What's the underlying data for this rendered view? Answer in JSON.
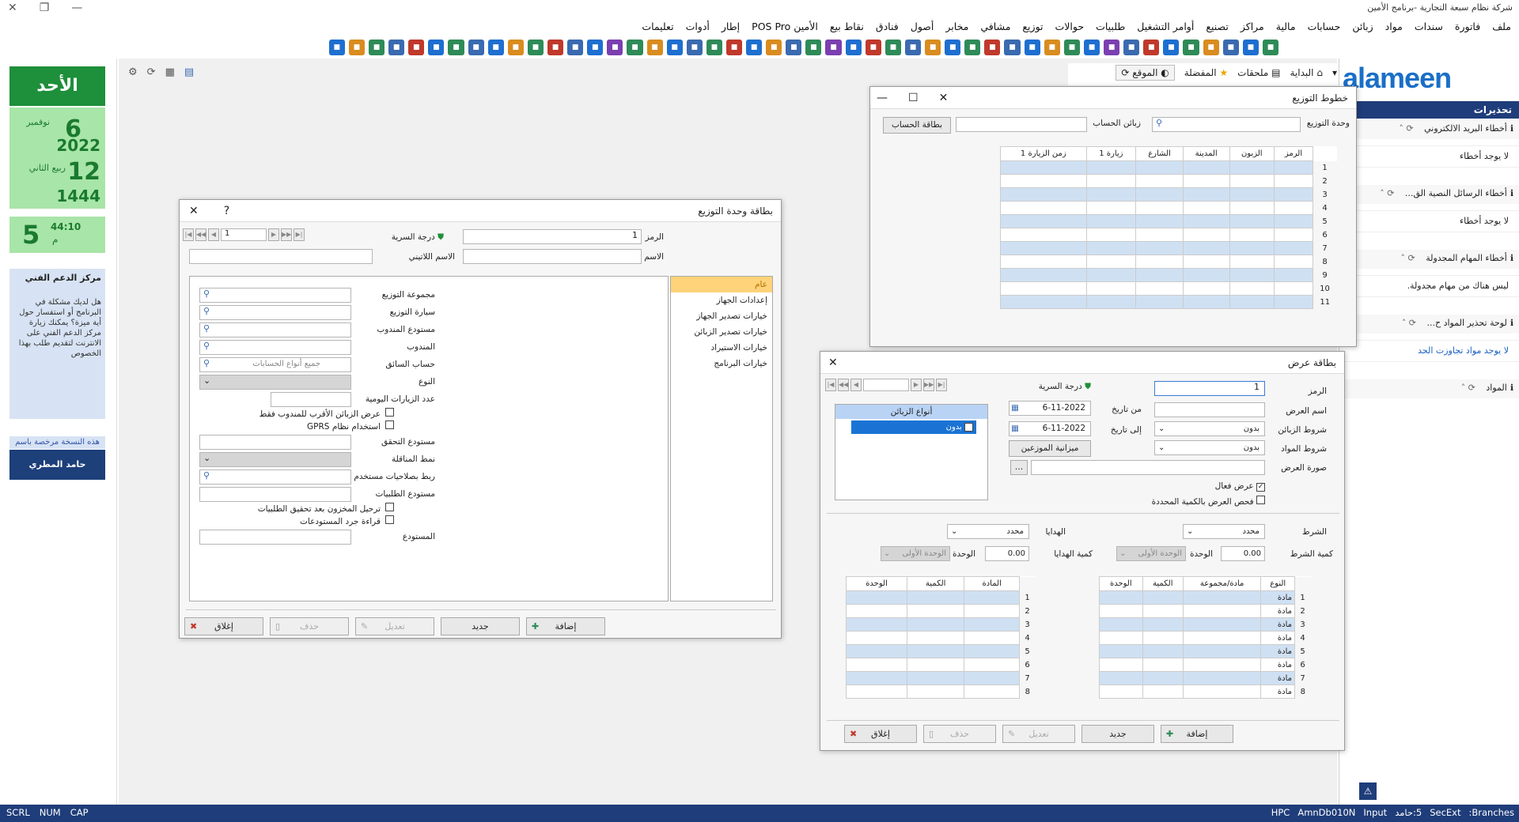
{
  "app_title": "شركة نظام سبعة التجارية -برنامج الأمين",
  "window_controls": {
    "close": "✕",
    "restore": "❐",
    "minimize": "—"
  },
  "menu": [
    "ملف",
    "فاتورة",
    "سندات",
    "مواد",
    "زبائن",
    "حسابات",
    "مالية",
    "مراكز",
    "تصنيع",
    "أوامر التشغيل",
    "طلبيات",
    "حوالات",
    "توزيع",
    "مشافي",
    "مخابر",
    "أصول",
    "فنادق",
    "نقاط بيع",
    "الأمين POS Pro",
    "إطار",
    "أدوات",
    "تعليمات"
  ],
  "tabs": {
    "home": "البداية",
    "notes": "ملحقات",
    "favorites": "المفضلة",
    "site": "الموقع"
  },
  "logo": "alameen",
  "left_panel": {
    "day": "الأحد",
    "greg_day": "6",
    "greg_month": "نوفمبر",
    "greg_year": "2022",
    "hijri_day": "12",
    "hijri_month": "ربيع الثاني",
    "hijri_year": "1444",
    "clock_min": "44:10",
    "clock_hour": "5",
    "clock_ampm": "م",
    "support_title": "مركز الدعم الفني",
    "support_text": "هل لديك مشكلة في البرنامج أو استفسار حول أية ميزة؟ يمكنك زيارة مركز الدعم الفني على الانترنت لتقديم طلب بهذا الخصوص",
    "license_label": "هذه النسخة مرخصة باسم",
    "license_user": "حامد المطري"
  },
  "right_panel": {
    "header": "تحذيرات",
    "items": [
      {
        "title": "أخطاء البريد الالكتروني",
        "body": "لا يوجد أخطاء"
      },
      {
        "title": "أخطاء الرسائل النصية الق...",
        "body": "لا يوجد أخطاء"
      },
      {
        "title": "أخطاء المهام المجدولة",
        "body": "ليس هناك من مهام مجدولة."
      },
      {
        "title": "لوحة تحذير المواد ح...",
        "body": "لا يوجد مواد تجاوزت الحد"
      },
      {
        "title": "المواد",
        "body": ""
      }
    ]
  },
  "status": {
    "left": [
      "SCRL",
      "NUM",
      "CAP"
    ],
    "right": [
      "Branches:",
      "SecExt",
      "5:حامد",
      "Input",
      "AmnDb010N",
      "HPC"
    ]
  },
  "dist_lines": {
    "title": "خطوط التوزيع",
    "unit_label": "وحدة التوزيع",
    "customers_label": "زبائن الحساب",
    "card_btn": "بطاقة الحساب",
    "columns": [
      "الرمز",
      "الزبون",
      "المدينة",
      "الشارع",
      "زيارة 1",
      "زمن الزيارة 1"
    ],
    "rows": [
      "1",
      "2",
      "3",
      "4",
      "5",
      "6",
      "7",
      "8",
      "9",
      "10",
      "11"
    ]
  },
  "dist_card": {
    "title": "بطاقة وحدة التوزيع",
    "help": "?",
    "code_label": "الرمز",
    "code_value": "1",
    "secrecy_label": "درجة السرية",
    "name_label": "الاسم",
    "latin_label": "الاسم اللاتيني",
    "nav_value": "1",
    "side_items": [
      "عام",
      "إعدادات الجهاز",
      "خيارات تصدير الجهاز",
      "خيارات تصدير الزبائن",
      "خيارات الاستيراد",
      "خيارات البرنامج"
    ],
    "fields": {
      "group": "مجموعة التوزيع",
      "car": "سيارة التوزيع",
      "rep_store": "مستودع المندوب",
      "rep": "المندوب",
      "driver_acc": "حساب السائق",
      "driver_acc_ph": "جميع أنواع الحسابات",
      "type": "النوع",
      "visits": "عدد الزيارات اليومية",
      "nearest": "عرض الزبائن الأقرب للمندوب فقط",
      "gprs": "استخدام نظام GPRS",
      "verify_store": "مستودع التحقق",
      "transfer_mode": "نمط المناقلة",
      "link_user": "ربط بصلاحيات مستخدم",
      "orders_store": "مستودع الطلبيات",
      "post_stock": "ترحيل المخزون بعد تحقيق الطلبيات",
      "read_inventory": "قراءة جرد المستودعات",
      "store": "المستودع"
    },
    "buttons": {
      "add": "إضافة",
      "new": "جديد",
      "edit": "تعديل",
      "delete": "حذف",
      "close": "إغلاق"
    }
  },
  "offer_card": {
    "title": "بطاقة عرض",
    "code_label": "الرمز",
    "code_value": "1",
    "secrecy_label": "درجة السرية",
    "offer_name": "اسم العرض",
    "from_date": "من تاريخ",
    "from_value": "6-11-2022",
    "to_date": "إلى تاريخ",
    "to_value": "6-11-2022",
    "cust_cond": "شروط الزبائن",
    "cust_cond_val": "بدون",
    "mat_cond": "شروط المواد",
    "mat_cond_val": "بدون",
    "budget_btn": "ميزانية الموزعين",
    "image_label": "صورة العرض",
    "ellipsis": "...",
    "active": "عرض فعال",
    "check_qty": "فحص العرض بالكمية المحددة",
    "cust_types": "أنواع الزبائن",
    "cust_type_item": "بدون",
    "cond_label": "الشرط",
    "cond_val": "محدد",
    "gifts_label": "الهدايا",
    "gifts_val": "محدد",
    "cond_qty": "كمية الشرط",
    "cond_qty_val": "0.00",
    "gift_qty": "كمية الهدايا",
    "gift_qty_val": "0.00",
    "unit_label": "الوحدة",
    "unit_val": "الوحدة الأولى",
    "left_cols": [
      "المادة",
      "الكمية",
      "الوحدة"
    ],
    "right_cols": [
      "النوع",
      "مادة/مجموعة",
      "الكمية",
      "الوحدة"
    ],
    "row_type": "مادة",
    "rows": [
      "1",
      "2",
      "3",
      "4",
      "5",
      "6",
      "7",
      "8"
    ],
    "buttons": {
      "add": "إضافة",
      "new": "جديد",
      "edit": "تعديل",
      "delete": "حذف",
      "close": "إغلاق"
    }
  },
  "colors": {
    "accent": "#1f3d7a",
    "green": "#1e8f3a",
    "light_green": "#a8e5a8",
    "grid_row": "#cfe0f3",
    "selected": "#ffd37a"
  }
}
